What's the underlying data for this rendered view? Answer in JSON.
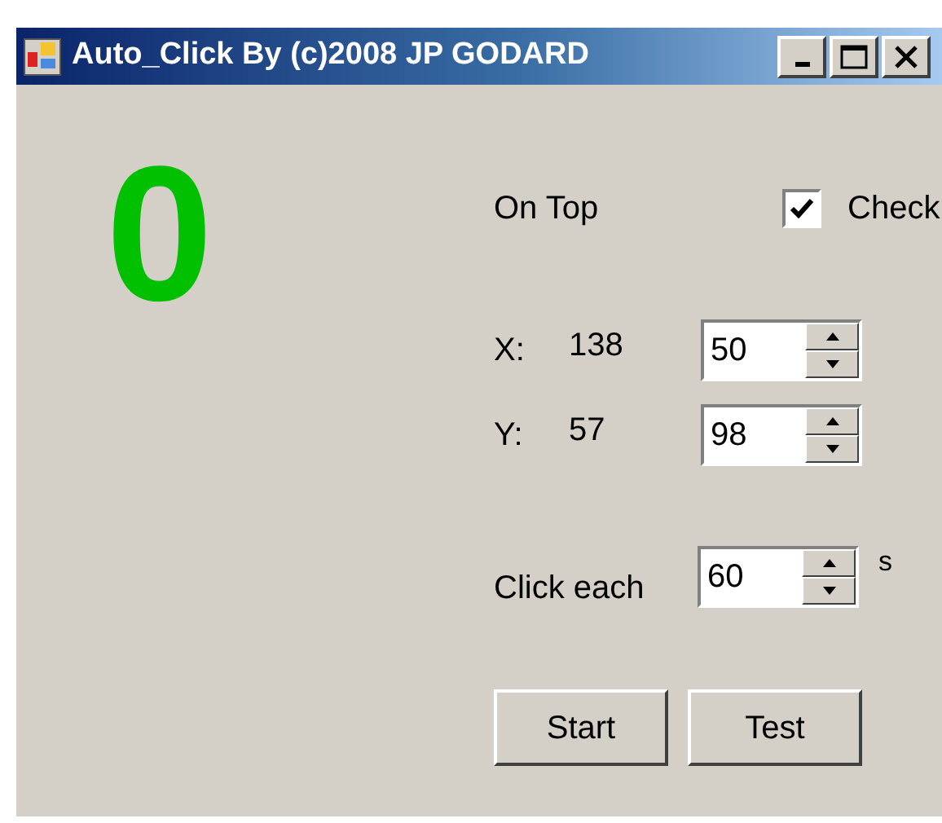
{
  "window": {
    "title": "Auto_Click By (c)2008 JP GODARD"
  },
  "counter": "0",
  "on_top": {
    "label": "On Top",
    "checkbox": {
      "label": "Check",
      "checked": true
    }
  },
  "coords": [
    {
      "label": "X:",
      "reading": "138",
      "value": "50"
    },
    {
      "label": "Y:",
      "reading": "57",
      "value": "98"
    }
  ],
  "interval": {
    "label": "Click each",
    "value": "60",
    "unit": "s"
  },
  "buttons": [
    "Start",
    "Test"
  ]
}
